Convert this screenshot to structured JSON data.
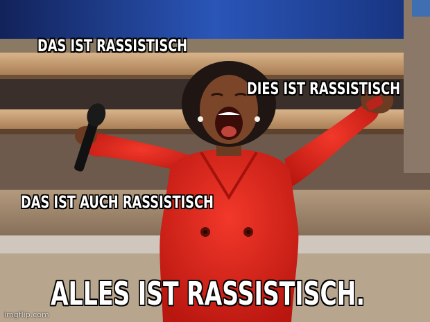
{
  "captions": {
    "top_left": "DAS IST RASSISTISCH",
    "top_right": "DIES IST RASSISTISCH",
    "middle_left": "DAS IST AUCH RASSISTISCH",
    "bottom": "ALLES IST RASSISTISCH."
  },
  "watermark": "imgflip.com",
  "colors": {
    "caption_text": "#ffffff",
    "caption_outline": "#000000",
    "outfit": "#e0241a",
    "stage_wood": "#c8a27a",
    "screen_blue": "#1f3f8f"
  }
}
